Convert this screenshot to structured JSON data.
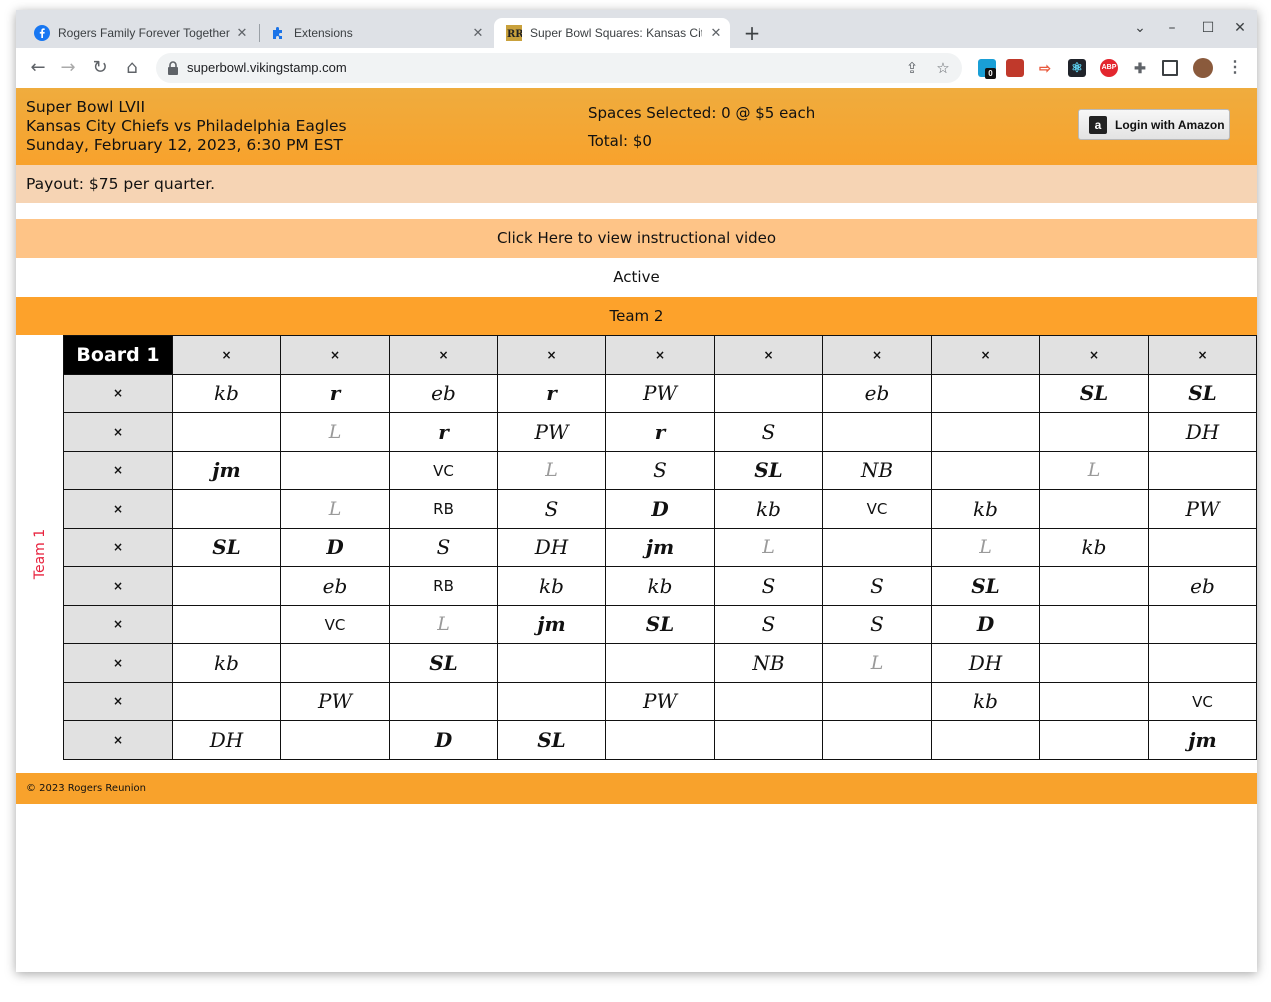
{
  "browser": {
    "tabs": [
      {
        "title": "Rogers Family Forever Together",
        "active": false,
        "icon": "facebook-icon"
      },
      {
        "title": "Extensions",
        "active": false,
        "icon": "puzzle-icon"
      },
      {
        "title": "Super Bowl Squares: Kansas City",
        "active": true,
        "icon": "rr-logo-icon"
      }
    ],
    "url": "superbowl.vikingstamp.com",
    "extension_badge": "0",
    "extensions": [
      "ghost-extension-icon",
      "bookmark-extension-icon",
      "arrow-extension-icon",
      "react-devtools-icon",
      "adblock-plus-icon",
      "extensions-puzzle-icon",
      "side-panel-icon",
      "profile-avatar",
      "menu-kebab-icon"
    ],
    "abp_label": "ABP"
  },
  "header": {
    "event": "Super Bowl LVII",
    "matchup": "Kansas City Chiefs vs Philadelphia Eagles",
    "datetime": "Sunday, February 12, 2023, 6:30 PM EST",
    "spaces_selected": "Spaces Selected: 0 @ $5 each",
    "total": "Total: $0",
    "login_button": "Login with Amazon",
    "amazon_logo": "a"
  },
  "payout": "Payout: $75 per quarter.",
  "video_link": "Click Here to view instructional video",
  "status": "Active",
  "team_top": "Team 2",
  "team_side": "Team 1",
  "board": {
    "title": "Board 1",
    "header_mark": "×",
    "rows": [
      [
        "kb",
        "r",
        "eb",
        "r",
        "PW",
        "",
        "eb",
        "",
        "SL",
        "SL"
      ],
      [
        "",
        "L",
        "r",
        "PW",
        "r",
        "S",
        "",
        "",
        "",
        "DH"
      ],
      [
        "jm",
        "",
        "VC",
        "L",
        "S",
        "SL",
        "NB",
        "",
        "L",
        ""
      ],
      [
        "",
        "L",
        "RB",
        "S",
        "D",
        "kb",
        "VC",
        "kb",
        "",
        "PW"
      ],
      [
        "SL",
        "D",
        "S",
        "DH",
        "jm",
        "L",
        "",
        "L",
        "kb",
        ""
      ],
      [
        "",
        "eb",
        "RB",
        "kb",
        "kb",
        "S",
        "S",
        "SL",
        "",
        "eb"
      ],
      [
        "",
        "VC",
        "L",
        "jm",
        "SL",
        "S",
        "S",
        "D",
        "",
        ""
      ],
      [
        "kb",
        "",
        "SL",
        "",
        "",
        "NB",
        "L",
        "DH",
        "",
        ""
      ],
      [
        "",
        "PW",
        "",
        "",
        "PW",
        "",
        "",
        "kb",
        "",
        "VC"
      ],
      [
        "DH",
        "",
        "D",
        "SL",
        "",
        "",
        "",
        "",
        "",
        "jm"
      ]
    ]
  },
  "footer": "© 2023 Rogers Reunion"
}
